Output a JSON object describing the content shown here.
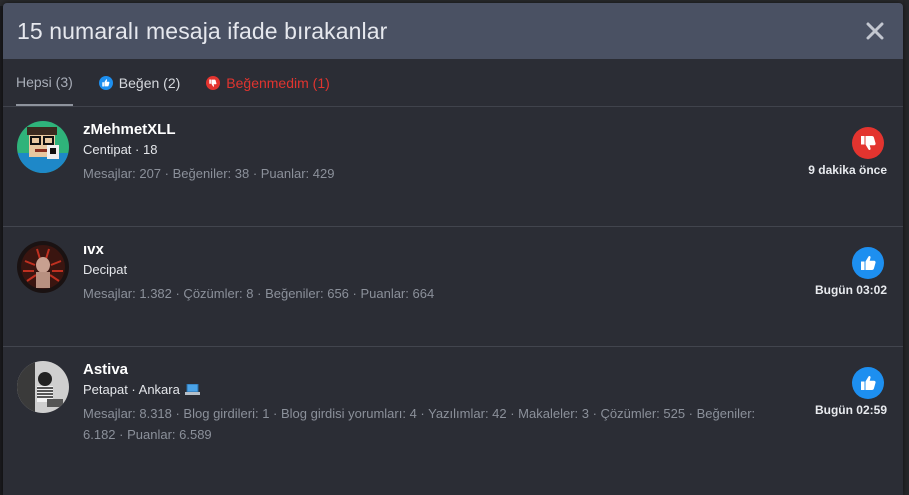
{
  "modal": {
    "title": "15 numaralı mesaja ifade bırakanlar"
  },
  "tabs": [
    {
      "label": "Hepsi (3)"
    },
    {
      "label": "Beğen (2)"
    },
    {
      "label": "Beğenmedim (1)"
    }
  ],
  "reactions": [
    {
      "username": "zMehmetXLL",
      "title": "Centipat · 18",
      "stats": "Mesajlar: 207 · Beğeniler: 38 · Puanlar: 429",
      "reaction": "dislike",
      "time": "9 dakika önce"
    },
    {
      "username": "ıvx",
      "title": "Decipat",
      "stats": "Mesajlar: 1.382 · Çözümler: 8 · Beğeniler: 656 · Puanlar: 664",
      "reaction": "like",
      "time": "Bugün 03:02"
    },
    {
      "username": "Astiva",
      "title": "Petapat · Ankara",
      "stats": "Mesajlar: 8.318 · Blog girdileri: 1 · Blog girdisi yorumları: 4 · Yazılımlar: 42 · Makaleler: 3 · Çözümler: 525 · Beğeniler: 6.182 · Puanlar: 6.589",
      "reaction": "like",
      "time": "Bugün 02:59"
    }
  ],
  "colors": {
    "header_bg": "#4a5163",
    "modal_bg": "#2b2d35",
    "like_blue": "#1d8ff0",
    "dislike_red": "#e3342f"
  },
  "icons": {
    "close": "close-icon",
    "like": "thumbs-up-icon",
    "dislike": "thumbs-down-icon",
    "laptop": "laptop-icon"
  }
}
